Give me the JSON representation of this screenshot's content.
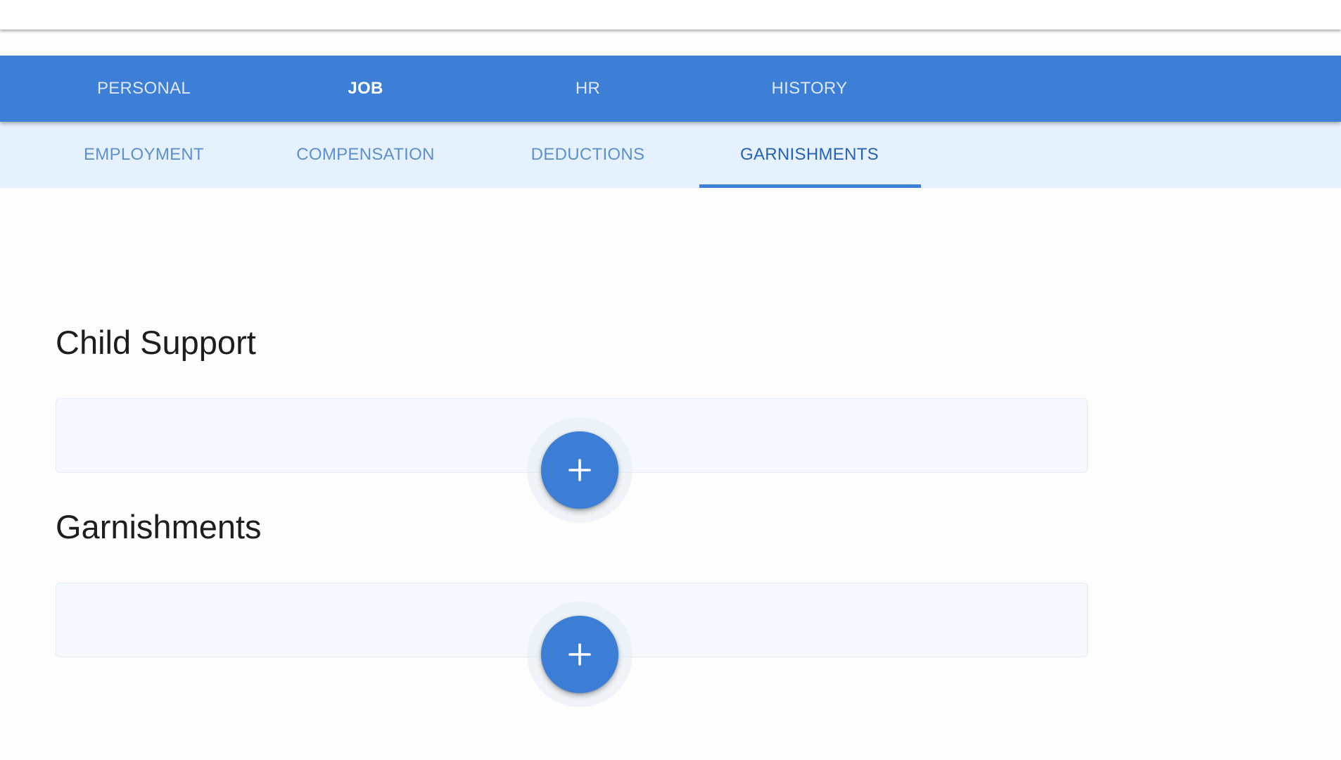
{
  "primary_tabs": [
    {
      "label": "PERSONAL",
      "active": false
    },
    {
      "label": "JOB",
      "active": true
    },
    {
      "label": "HR",
      "active": false
    },
    {
      "label": "HISTORY",
      "active": false
    }
  ],
  "secondary_tabs": [
    {
      "label": "EMPLOYMENT",
      "active": false
    },
    {
      "label": "COMPENSATION",
      "active": false
    },
    {
      "label": "DEDUCTIONS",
      "active": false
    },
    {
      "label": "GARNISHMENTS",
      "active": true
    }
  ],
  "sections": [
    {
      "title": "Child Support",
      "add_icon": "plus-icon"
    },
    {
      "title": "Garnishments",
      "add_icon": "plus-icon"
    }
  ],
  "colors": {
    "primary": "#3d7fd6",
    "secondary_bar": "#e5f1fc",
    "active_tab_text": "#2761b8"
  }
}
